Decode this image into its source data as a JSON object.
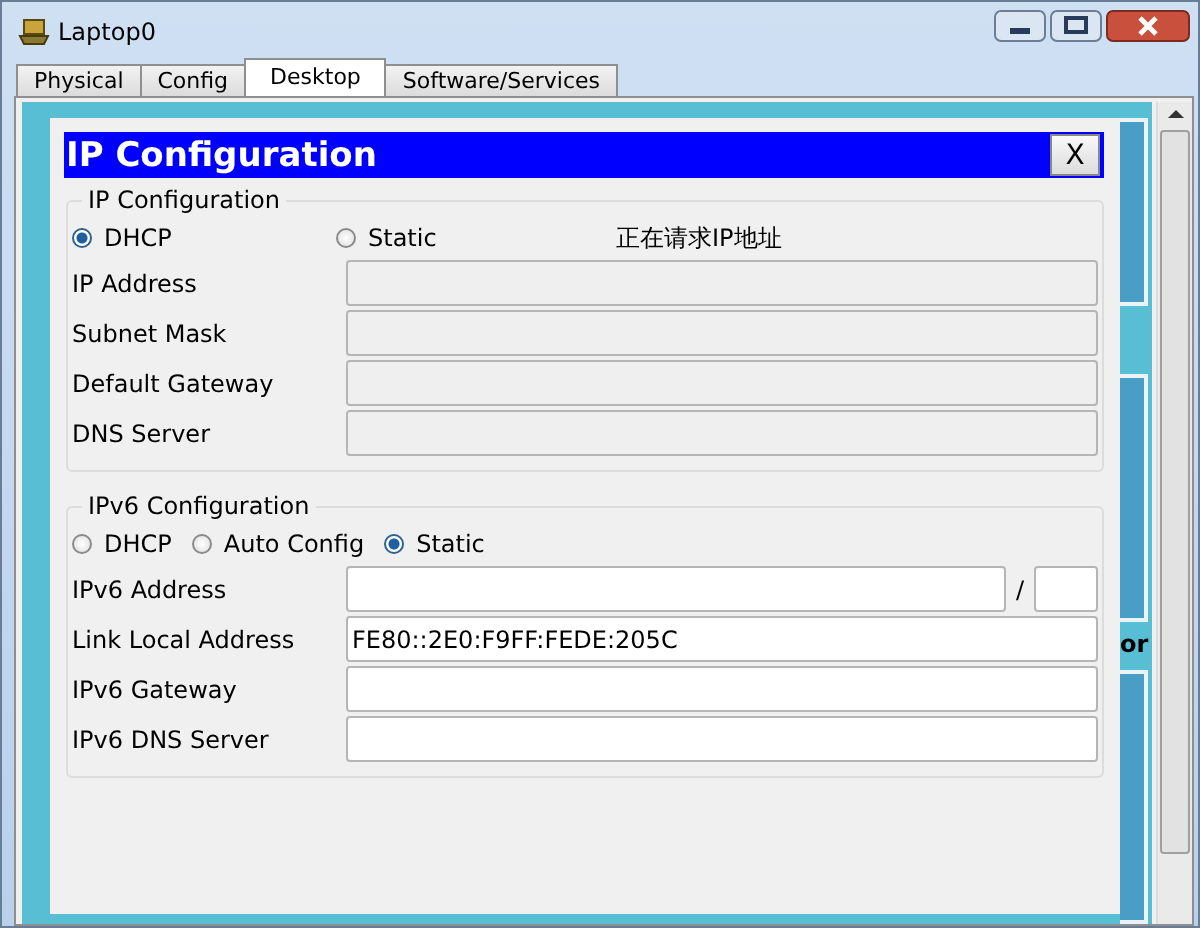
{
  "window": {
    "title": "Laptop0"
  },
  "tabs": [
    {
      "label": "Physical",
      "selected": false
    },
    {
      "label": "Config",
      "selected": false
    },
    {
      "label": "Desktop",
      "selected": true
    },
    {
      "label": "Software/Services",
      "selected": false
    }
  ],
  "desktop": {
    "label_fragment": "or"
  },
  "dialog": {
    "title": "IP Configuration",
    "close": "X",
    "ipv4": {
      "legend": "IP Configuration",
      "modes": [
        {
          "label": "DHCP",
          "selected": true
        },
        {
          "label": "Static",
          "selected": false
        }
      ],
      "status": "正在请求IP地址",
      "fields": [
        {
          "label": "IP Address",
          "disabled": true
        },
        {
          "label": "Subnet Mask",
          "disabled": true
        },
        {
          "label": "Default Gateway",
          "disabled": true
        },
        {
          "label": "DNS Server",
          "disabled": true
        }
      ]
    },
    "ipv6": {
      "legend": "IPv6 Configuration",
      "modes": [
        {
          "label": "DHCP",
          "selected": false
        },
        {
          "label": "Auto Config",
          "selected": false
        },
        {
          "label": "Static",
          "selected": true
        }
      ],
      "prefix_separator": "/",
      "fields": [
        {
          "label": "IPv6 Address",
          "disabled": false,
          "kind": "prefixed"
        },
        {
          "label": "Link Local Address",
          "value": "FE80::2E0:F9FF:FEDE:205C",
          "disabled": false,
          "kind": "plain"
        },
        {
          "label": "IPv6 Gateway",
          "disabled": false,
          "kind": "plain"
        },
        {
          "label": "IPv6 DNS Server",
          "disabled": false,
          "kind": "plain"
        }
      ]
    }
  }
}
